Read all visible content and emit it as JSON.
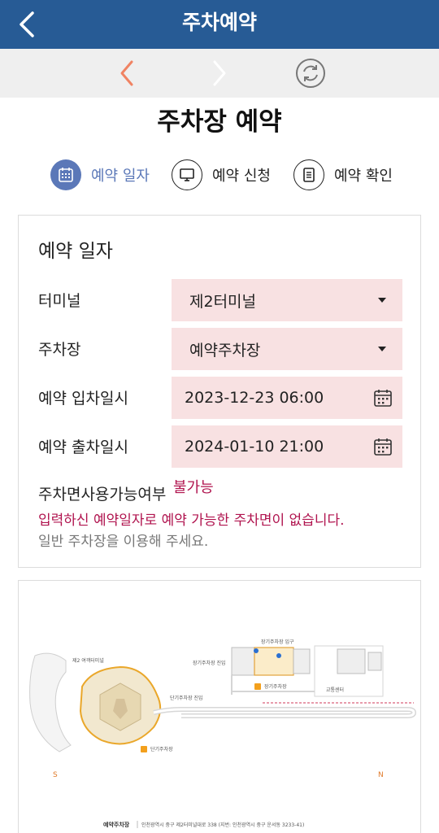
{
  "appbar": {
    "title": "주차예약"
  },
  "page": {
    "title": "주차장 예약"
  },
  "steps": [
    {
      "label": "예약 일자",
      "active": true
    },
    {
      "label": "예약 신청",
      "active": false
    },
    {
      "label": "예약 확인",
      "active": false
    }
  ],
  "form": {
    "title": "예약 일자",
    "terminal": {
      "label": "터미널",
      "value": "제2터미널"
    },
    "parking": {
      "label": "주차장",
      "value": "예약주차장"
    },
    "entry": {
      "label": "예약 입차일시",
      "value": "2023-12-23 06:00"
    },
    "exit": {
      "label": "예약 출차일시",
      "value": "2024-01-10 21:00"
    },
    "availability": {
      "label": "주차면사용가능여부",
      "value": "불가능"
    },
    "message_error": "입력하신 예약일자로 예약 가능한 주차면이 없습니다.",
    "message_info": "일반 주차장을 이용해 주세요."
  },
  "map": {
    "terminal_label": "제2 여객터미널",
    "long_term_entry": "장기주차장 진입",
    "long_term_lot_entrance": "장기주차장 입구",
    "short_term_entry": "단기주차장 진입",
    "long_term_lot": "장기주차장",
    "short_term_lot": "단기주차장",
    "reservation_lot_tag": "예약주차장",
    "transport_center": "교통센터",
    "south": "S",
    "north": "N",
    "footer_title": "예약주차장",
    "footer_address": "인천광역시 중구 제2터미널대로 338 (지번: 인천광역시 중구 운서동 3233-41)"
  },
  "colors": {
    "appbar": "#275b95",
    "accent": "#5b78b8",
    "field_bg": "#f8e1e2",
    "error": "#b0134e",
    "back_active": "#f08363"
  }
}
